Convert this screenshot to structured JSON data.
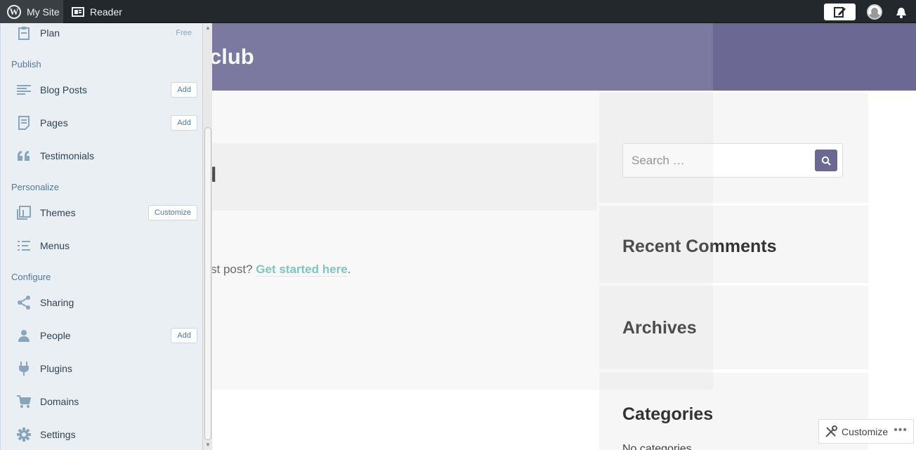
{
  "masterbar": {
    "my_site": "My Site",
    "reader": "Reader"
  },
  "site": {
    "title_fragment": "club",
    "entry_glyph": "d",
    "post_text_prefix": "st post? ",
    "post_link": "Get started here",
    "post_text_suffix": "."
  },
  "widgets": {
    "search_placeholder": "Search …",
    "recent_comments": "Recent Comments",
    "archives": "Archives",
    "categories": "Categories",
    "no_categories": "No categories"
  },
  "sidebar": {
    "plan": {
      "label": "Plan",
      "badge": "Free"
    },
    "sections": {
      "publish": "Publish",
      "personalize": "Personalize",
      "configure": "Configure"
    },
    "items": {
      "blog_posts": {
        "label": "Blog Posts",
        "button": "Add"
      },
      "pages": {
        "label": "Pages",
        "button": "Add"
      },
      "testimonials": {
        "label": "Testimonials"
      },
      "themes": {
        "label": "Themes",
        "button": "Customize"
      },
      "menus": {
        "label": "Menus"
      },
      "sharing": {
        "label": "Sharing"
      },
      "people": {
        "label": "People",
        "button": "Add"
      },
      "plugins": {
        "label": "Plugins"
      },
      "domains": {
        "label": "Domains"
      },
      "settings": {
        "label": "Settings"
      }
    }
  },
  "customize_fab": {
    "label": "Customize"
  },
  "colors": {
    "accent": "#6b6894",
    "sidebar_bg": "#e9eff3",
    "link": "#72c3b7",
    "masterbar": "#23282d"
  }
}
